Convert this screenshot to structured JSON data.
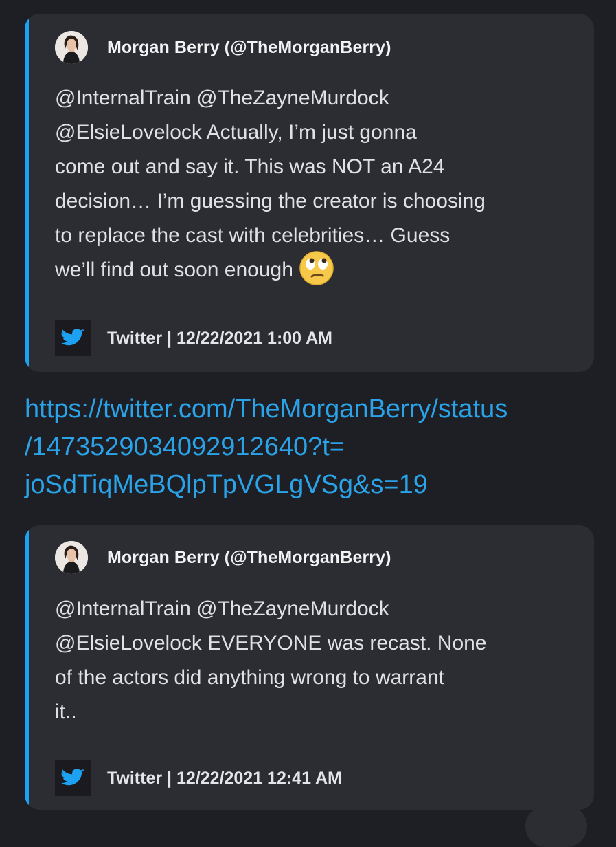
{
  "embeds": [
    {
      "author": "Morgan Berry (@TheMorganBerry)",
      "lines": [
        "@InternalTrain @TheZayneMurdock",
        "@ElsieLovelock Actually, I’m just gonna",
        "come out and say it. This was NOT an A24",
        "decision… I’m guessing the creator is choosing",
        "to replace the cast with celebrities… Guess",
        "we’ll find out soon enough"
      ],
      "emoji": "face-with-rolling-eyes-icon",
      "footer": "Twitter | 12/22/2021 1:00 AM"
    },
    {
      "author": "Morgan Berry (@TheMorganBerry)",
      "lines": [
        "@InternalTrain @TheZayneMurdock",
        "@ElsieLovelock EVERYONE was recast. None",
        "of the actors did anything wrong to warrant",
        "it.."
      ],
      "footer": "Twitter | 12/22/2021 12:41 AM"
    }
  ],
  "link": {
    "lines": [
      "https://twitter.com/TheMorganBerry/status",
      "/1473529034092912640?t=",
      "joSdTiqMeBQlpTpVGLgVSg&s=19"
    ]
  },
  "colors": {
    "background": "#1e1f25",
    "embed_bg": "#2b2d33",
    "accent": "#1da1f2",
    "link": "#2aa3e8"
  }
}
